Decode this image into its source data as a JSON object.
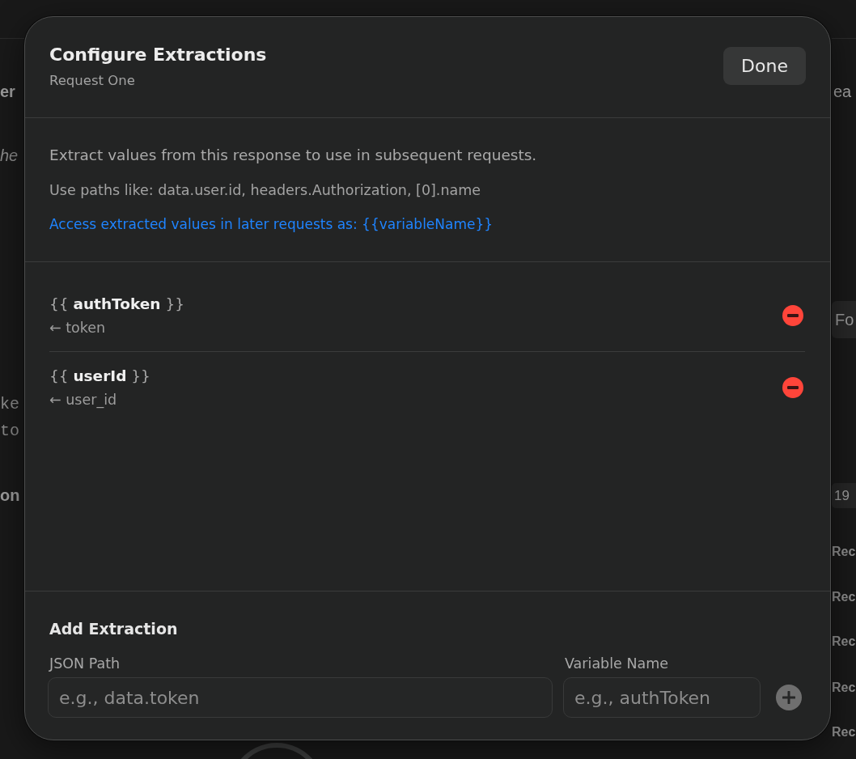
{
  "background": {
    "left_items": [
      {
        "text": "er",
        "kind": "heading"
      },
      {
        "text": "he",
        "kind": "italic"
      },
      {
        "text": "ke",
        "kind": "mono"
      },
      {
        "text": "to",
        "kind": "mono"
      },
      {
        "text": "on",
        "kind": "heading"
      }
    ],
    "right_items": [
      {
        "text": "ea",
        "kind": "heading"
      },
      {
        "text": "Fo",
        "kind": "field"
      },
      {
        "text": "19",
        "kind": "badge"
      },
      {
        "text": "Rec",
        "kind": "row"
      },
      {
        "text": "Rec",
        "kind": "row"
      },
      {
        "text": "Rec",
        "kind": "row"
      },
      {
        "text": "Rec",
        "kind": "row"
      },
      {
        "text": "Rec",
        "kind": "row"
      }
    ]
  },
  "dialog": {
    "title": "Configure Extractions",
    "subtitle": "Request One",
    "done_button": "Done"
  },
  "info": {
    "description": "Extract values from this response to use in subsequent requests.",
    "hint": "Use paths like: data.user.id, headers.Authorization, [0].name",
    "usage": "Access extracted values in later requests as: {{variableName}}"
  },
  "extractions": [
    {
      "variable": "{{ **authToken** }}",
      "source": "← token"
    },
    {
      "variable": "{{ **userId** }}",
      "source": "← user_id"
    }
  ],
  "add_extraction": {
    "title": "Add Extraction",
    "fields": [
      {
        "label": "JSON Path",
        "placeholder": "e.g., data.token"
      },
      {
        "label": "Variable Name",
        "placeholder": "e.g., authToken"
      }
    ]
  }
}
